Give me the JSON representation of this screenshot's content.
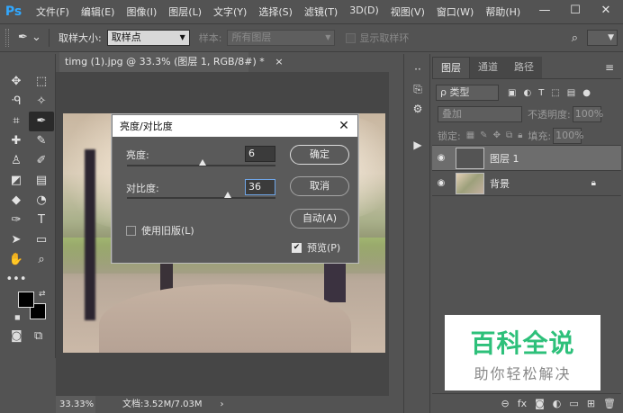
{
  "app": {
    "logo": "Ps",
    "menu": [
      "文件(F)",
      "编辑(E)",
      "图像(I)",
      "图层(L)",
      "文字(Y)",
      "选择(S)",
      "滤镜(T)",
      "3D(D)",
      "视图(V)",
      "窗口(W)",
      "帮助(H)"
    ],
    "window_controls": [
      "—",
      "☐",
      "✕"
    ],
    "accent_color": "#31a8ff"
  },
  "options_bar": {
    "sample_size_label": "取样大小:",
    "sample_size_value": "取样点",
    "sample_label": "样本:",
    "sample_value": "所有图层",
    "show_ring_label": "显示取样环"
  },
  "document": {
    "tab_title": "timg (1).jpg @ 33.3% (图层 1, RGB/8#) *",
    "tab_close": "×",
    "zoom": "33.33%",
    "doc_size": "文档:3.52M/7.03M",
    "status_arrow": "›"
  },
  "dialog": {
    "title": "亮度/对比度",
    "close": "✕",
    "brightness_label": "亮度:",
    "brightness_value": "6",
    "brightness_level": 0.51,
    "contrast_label": "对比度:",
    "contrast_value": "36",
    "contrast_level": 0.68,
    "ok_label": "确定",
    "cancel_label": "取消",
    "auto_label": "自动(A)",
    "legacy_label": "使用旧版(L)",
    "legacy_checked": false,
    "preview_label": "预览(P)",
    "preview_checked": true
  },
  "layers_panel": {
    "tabs": [
      "图层",
      "通道",
      "路径"
    ],
    "active_tab": 0,
    "menu_icon": "≡",
    "filter_label": "ρ 类型",
    "blend_mode": "叠加",
    "opacity_label": "不透明度:",
    "opacity_value": "100%",
    "lock_label": "锁定:",
    "fill_label": "填充:",
    "fill_value": "100%",
    "layers": [
      {
        "name": "图层 1",
        "selected": true,
        "locked": false
      },
      {
        "name": "背景",
        "selected": false,
        "locked": true
      }
    ],
    "footer_icons": [
      "link-icon",
      "fx-icon",
      "mask-icon",
      "adjustment-icon",
      "group-icon",
      "new-layer-icon",
      "trash-icon"
    ]
  },
  "watermark": {
    "title": "百科全说",
    "subtitle": "助你轻松解决",
    "color": "#2dc07a"
  }
}
